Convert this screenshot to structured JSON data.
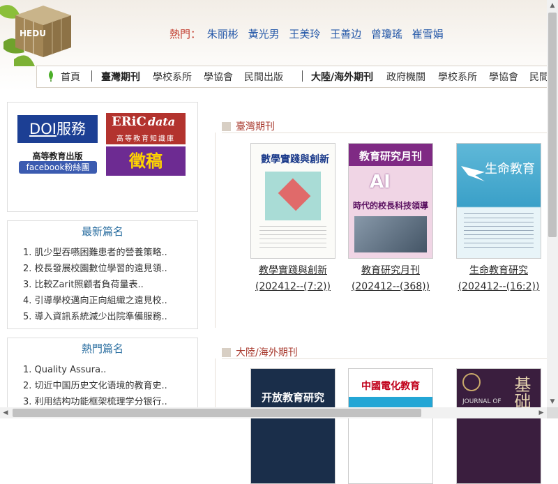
{
  "header": {
    "logo_text": "HEDU",
    "hot_label": "熱門：",
    "hot_authors": [
      "朱丽彬",
      "黃光男",
      "王美玲",
      "王善边",
      "曾瓊瑤",
      "崔雪娟"
    ]
  },
  "nav": {
    "items": [
      "首頁",
      "臺灣期刊",
      "學校系所",
      "學協會",
      "民間出版",
      "大陸/海外期刊",
      "政府機關",
      "學校系所",
      "學協會",
      "民間"
    ]
  },
  "services": {
    "doi": "DOI",
    "doi_suffix": "服務",
    "eric": "ERiC",
    "eric_data": "data",
    "eric_sub": "高等教育知識庫",
    "hep": "高等教育出版",
    "facebook": "facebook粉絲團",
    "zhenggao": "徵稿"
  },
  "latest": {
    "title": "最新篇名",
    "items": [
      "1. 肌少型吞嚥困難患者的營養策略..",
      "2. 校長發展校園數位學習的遠見領..",
      "3. 比較Zarit照顧者負荷量表..",
      "4. 引導學校邁向正向組織之遠見校..",
      "5. 導入資訊系統減少出院準備服務.."
    ]
  },
  "hot": {
    "title": "熱門篇名",
    "items": [
      "1. Quality Assura..",
      "2. 切近中国历史文化语境的教育史..",
      "3. 利用结构功能框架梳理学分银行.."
    ]
  },
  "taiwan": {
    "title": "臺灣期刊",
    "journals": [
      {
        "cover_title": "數學實踐與創新",
        "name": "教學實踐與創新",
        "issue": "(202412--(7:2))"
      },
      {
        "cover_title": "教育研究月刊",
        "cover_ai": "AI",
        "cover_sub": "時代的校長科技領導",
        "name": "教育研究月刊",
        "issue": "(202412--(368))"
      },
      {
        "cover_title": "生命教育",
        "name": "生命教育研究",
        "issue": "(202412--(16:2))"
      }
    ]
  },
  "overseas": {
    "title": "大陸/海外期刊",
    "journals": [
      {
        "cover_title": "开放教育研究"
      },
      {
        "cover_title": "中國電化教育"
      },
      {
        "cover_title": "JOURNAL OF",
        "cover_big": "基础"
      }
    ]
  },
  "colors": {
    "accent_red": "#c0392b",
    "link_blue": "#2357a8",
    "panel_title": "#2a6ea0"
  }
}
